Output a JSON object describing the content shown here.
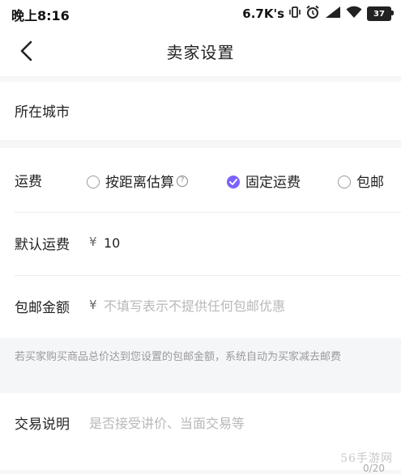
{
  "status_bar": {
    "time": "晚上8:16",
    "net_speed": "6.7K's",
    "battery": "37"
  },
  "header": {
    "title": "卖家设置"
  },
  "city": {
    "label": "所在城市"
  },
  "shipping": {
    "label": "运费",
    "options": [
      {
        "label": "按距离估算",
        "checked": false,
        "help": "?"
      },
      {
        "label": "固定运费",
        "checked": true
      },
      {
        "label": "包邮",
        "checked": false
      }
    ]
  },
  "default_fee": {
    "label": "默认运费",
    "currency": "¥",
    "value": "10"
  },
  "free_shipping": {
    "label": "包邮金额",
    "currency": "¥",
    "placeholder": "不填写表示不提供任何包邮优惠"
  },
  "tip": {
    "text": "若买家购买商品总价达到您设置的包邮金额，系统自动为买家减去邮费"
  },
  "trade_note": {
    "label": "交易说明",
    "placeholder": "是否接受讲价、当面交易等",
    "counter": "0/20"
  },
  "watermark": "56手游网"
}
